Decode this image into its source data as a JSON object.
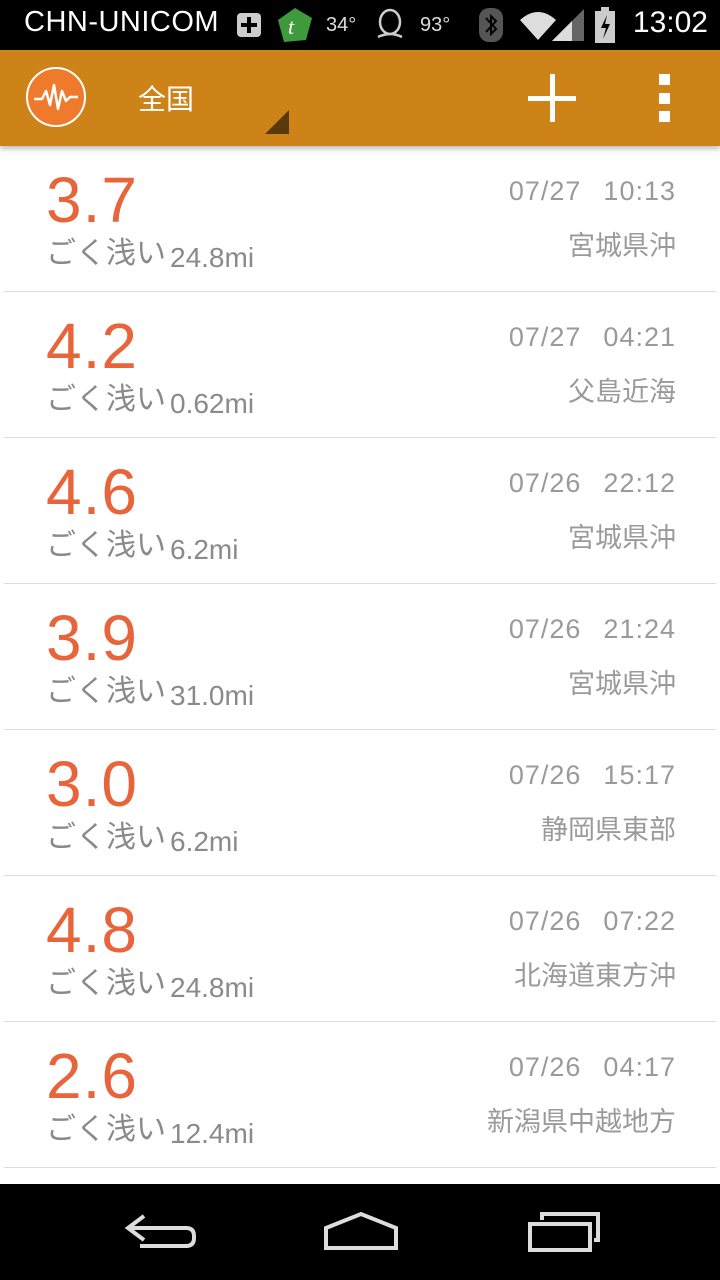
{
  "status_bar": {
    "carrier": "CHN-UNICOM",
    "temperature": "34°",
    "battery_level": "93°",
    "time": "13:02"
  },
  "app_bar": {
    "region": "全国",
    "icons": {
      "logo": "earthquake-wave-icon",
      "add": "plus-icon",
      "overflow": "overflow-menu-icon"
    },
    "accent_color": "#cd8318"
  },
  "quakes": [
    {
      "magnitude": "3.7",
      "depth_label": "ごく浅い",
      "depth": "24.8mi",
      "date": "07/27",
      "time": "10:13",
      "place": "宮城県沖"
    },
    {
      "magnitude": "4.2",
      "depth_label": "ごく浅い",
      "depth": "0.62mi",
      "date": "07/27",
      "time": "04:21",
      "place": "父島近海"
    },
    {
      "magnitude": "4.6",
      "depth_label": "ごく浅い",
      "depth": "6.2mi",
      "date": "07/26",
      "time": "22:12",
      "place": "宮城県沖"
    },
    {
      "magnitude": "3.9",
      "depth_label": "ごく浅い",
      "depth": "31.0mi",
      "date": "07/26",
      "time": "21:24",
      "place": "宮城県沖"
    },
    {
      "magnitude": "3.0",
      "depth_label": "ごく浅い",
      "depth": "6.2mi",
      "date": "07/26",
      "time": "15:17",
      "place": "静岡県東部"
    },
    {
      "magnitude": "4.8",
      "depth_label": "ごく浅い",
      "depth": "24.8mi",
      "date": "07/26",
      "time": "07:22",
      "place": "北海道東方沖"
    },
    {
      "magnitude": "2.6",
      "depth_label": "ごく浅い",
      "depth": "12.4mi",
      "date": "07/26",
      "time": "04:17",
      "place": "新潟県中越地方"
    }
  ],
  "colors": {
    "magnitude": "#e8643a",
    "secondary_text": "#9a9a9a"
  },
  "nav_bar": {
    "back": "back-icon",
    "home": "home-icon",
    "recents": "recents-icon"
  }
}
